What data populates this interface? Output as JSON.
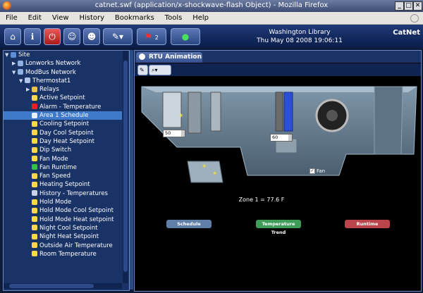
{
  "window": {
    "title": "catnet.swf (application/x-shockwave-flash Object) - Mozilla Firefox"
  },
  "menu": [
    "File",
    "Edit",
    "View",
    "History",
    "Bookmarks",
    "Tools",
    "Help"
  ],
  "toolbar": {
    "library": "Washington Library",
    "datetime": "Thu May 08 2008 19:06:11",
    "brand": "CatNet",
    "alarm_count": "2"
  },
  "tree": [
    {
      "label": "Site",
      "icon": "site-icon",
      "level": 0,
      "twisty": "▼"
    },
    {
      "label": "Lonworks Network",
      "icon": "network-icon",
      "level": 1,
      "twisty": "▶"
    },
    {
      "label": "ModBus Network",
      "icon": "network-icon",
      "level": 1,
      "twisty": "▼"
    },
    {
      "label": "Thermostat1",
      "icon": "thermostat-icon",
      "level": 2,
      "twisty": "▼"
    },
    {
      "label": "Relays",
      "icon": "folder-icon",
      "level": 3,
      "twisty": "▶"
    },
    {
      "label": "Active Setpoint",
      "icon": "bulb-icon",
      "level": 3
    },
    {
      "label": "Alarm - Temperature",
      "icon": "flag-icon",
      "level": 3
    },
    {
      "label": "Area  1 Schedule",
      "icon": "clock-icon",
      "level": 3,
      "selected": true
    },
    {
      "label": "Cooling Setpoint",
      "icon": "bulb-icon",
      "level": 3
    },
    {
      "label": "Day Cool Setpoint",
      "icon": "bulb-icon",
      "level": 3
    },
    {
      "label": "Day Heat Setpoint",
      "icon": "bulb-icon",
      "level": 3
    },
    {
      "label": "Dip Switch",
      "icon": "bulb-icon",
      "level": 3
    },
    {
      "label": "Fan Mode",
      "icon": "bulb-icon",
      "level": 3
    },
    {
      "label": "Fan Runtime",
      "icon": "runtime-icon",
      "level": 3
    },
    {
      "label": "Fan Speed",
      "icon": "bulb-icon",
      "level": 3
    },
    {
      "label": "Heating Setpoint",
      "icon": "bulb-icon",
      "level": 3
    },
    {
      "label": "History - Temperatures",
      "icon": "history-icon",
      "level": 3
    },
    {
      "label": "Hold Mode",
      "icon": "bulb-icon",
      "level": 3
    },
    {
      "label": "Hold Mode Cool Setpoint",
      "icon": "bulb-icon",
      "level": 3
    },
    {
      "label": "Hold Mode Heat setpoint",
      "icon": "bulb-icon",
      "level": 3
    },
    {
      "label": "Night Cool Setpoint",
      "icon": "bulb-icon",
      "level": 3
    },
    {
      "label": "Night Heat Setpoint",
      "icon": "bulb-icon",
      "level": 3
    },
    {
      "label": "Outside Air Temperature",
      "icon": "bulb-icon",
      "level": 3
    },
    {
      "label": "Room Temperature",
      "icon": "bulb-icon",
      "level": 3
    }
  ],
  "panel": {
    "tab_label": "RTU Animation",
    "input_left": "50",
    "input_right": "60",
    "fan_label": "Fan",
    "fan_checked": true,
    "zone_text": "Zone 1 = 77.6 F",
    "buttons": {
      "schedule": "Schedule",
      "trend": "Temperature Trend",
      "runtime": "Runtime"
    }
  },
  "colors": {
    "schedule": "#5f7fa8",
    "trend": "#3f9b58",
    "runtime": "#b9454a"
  }
}
